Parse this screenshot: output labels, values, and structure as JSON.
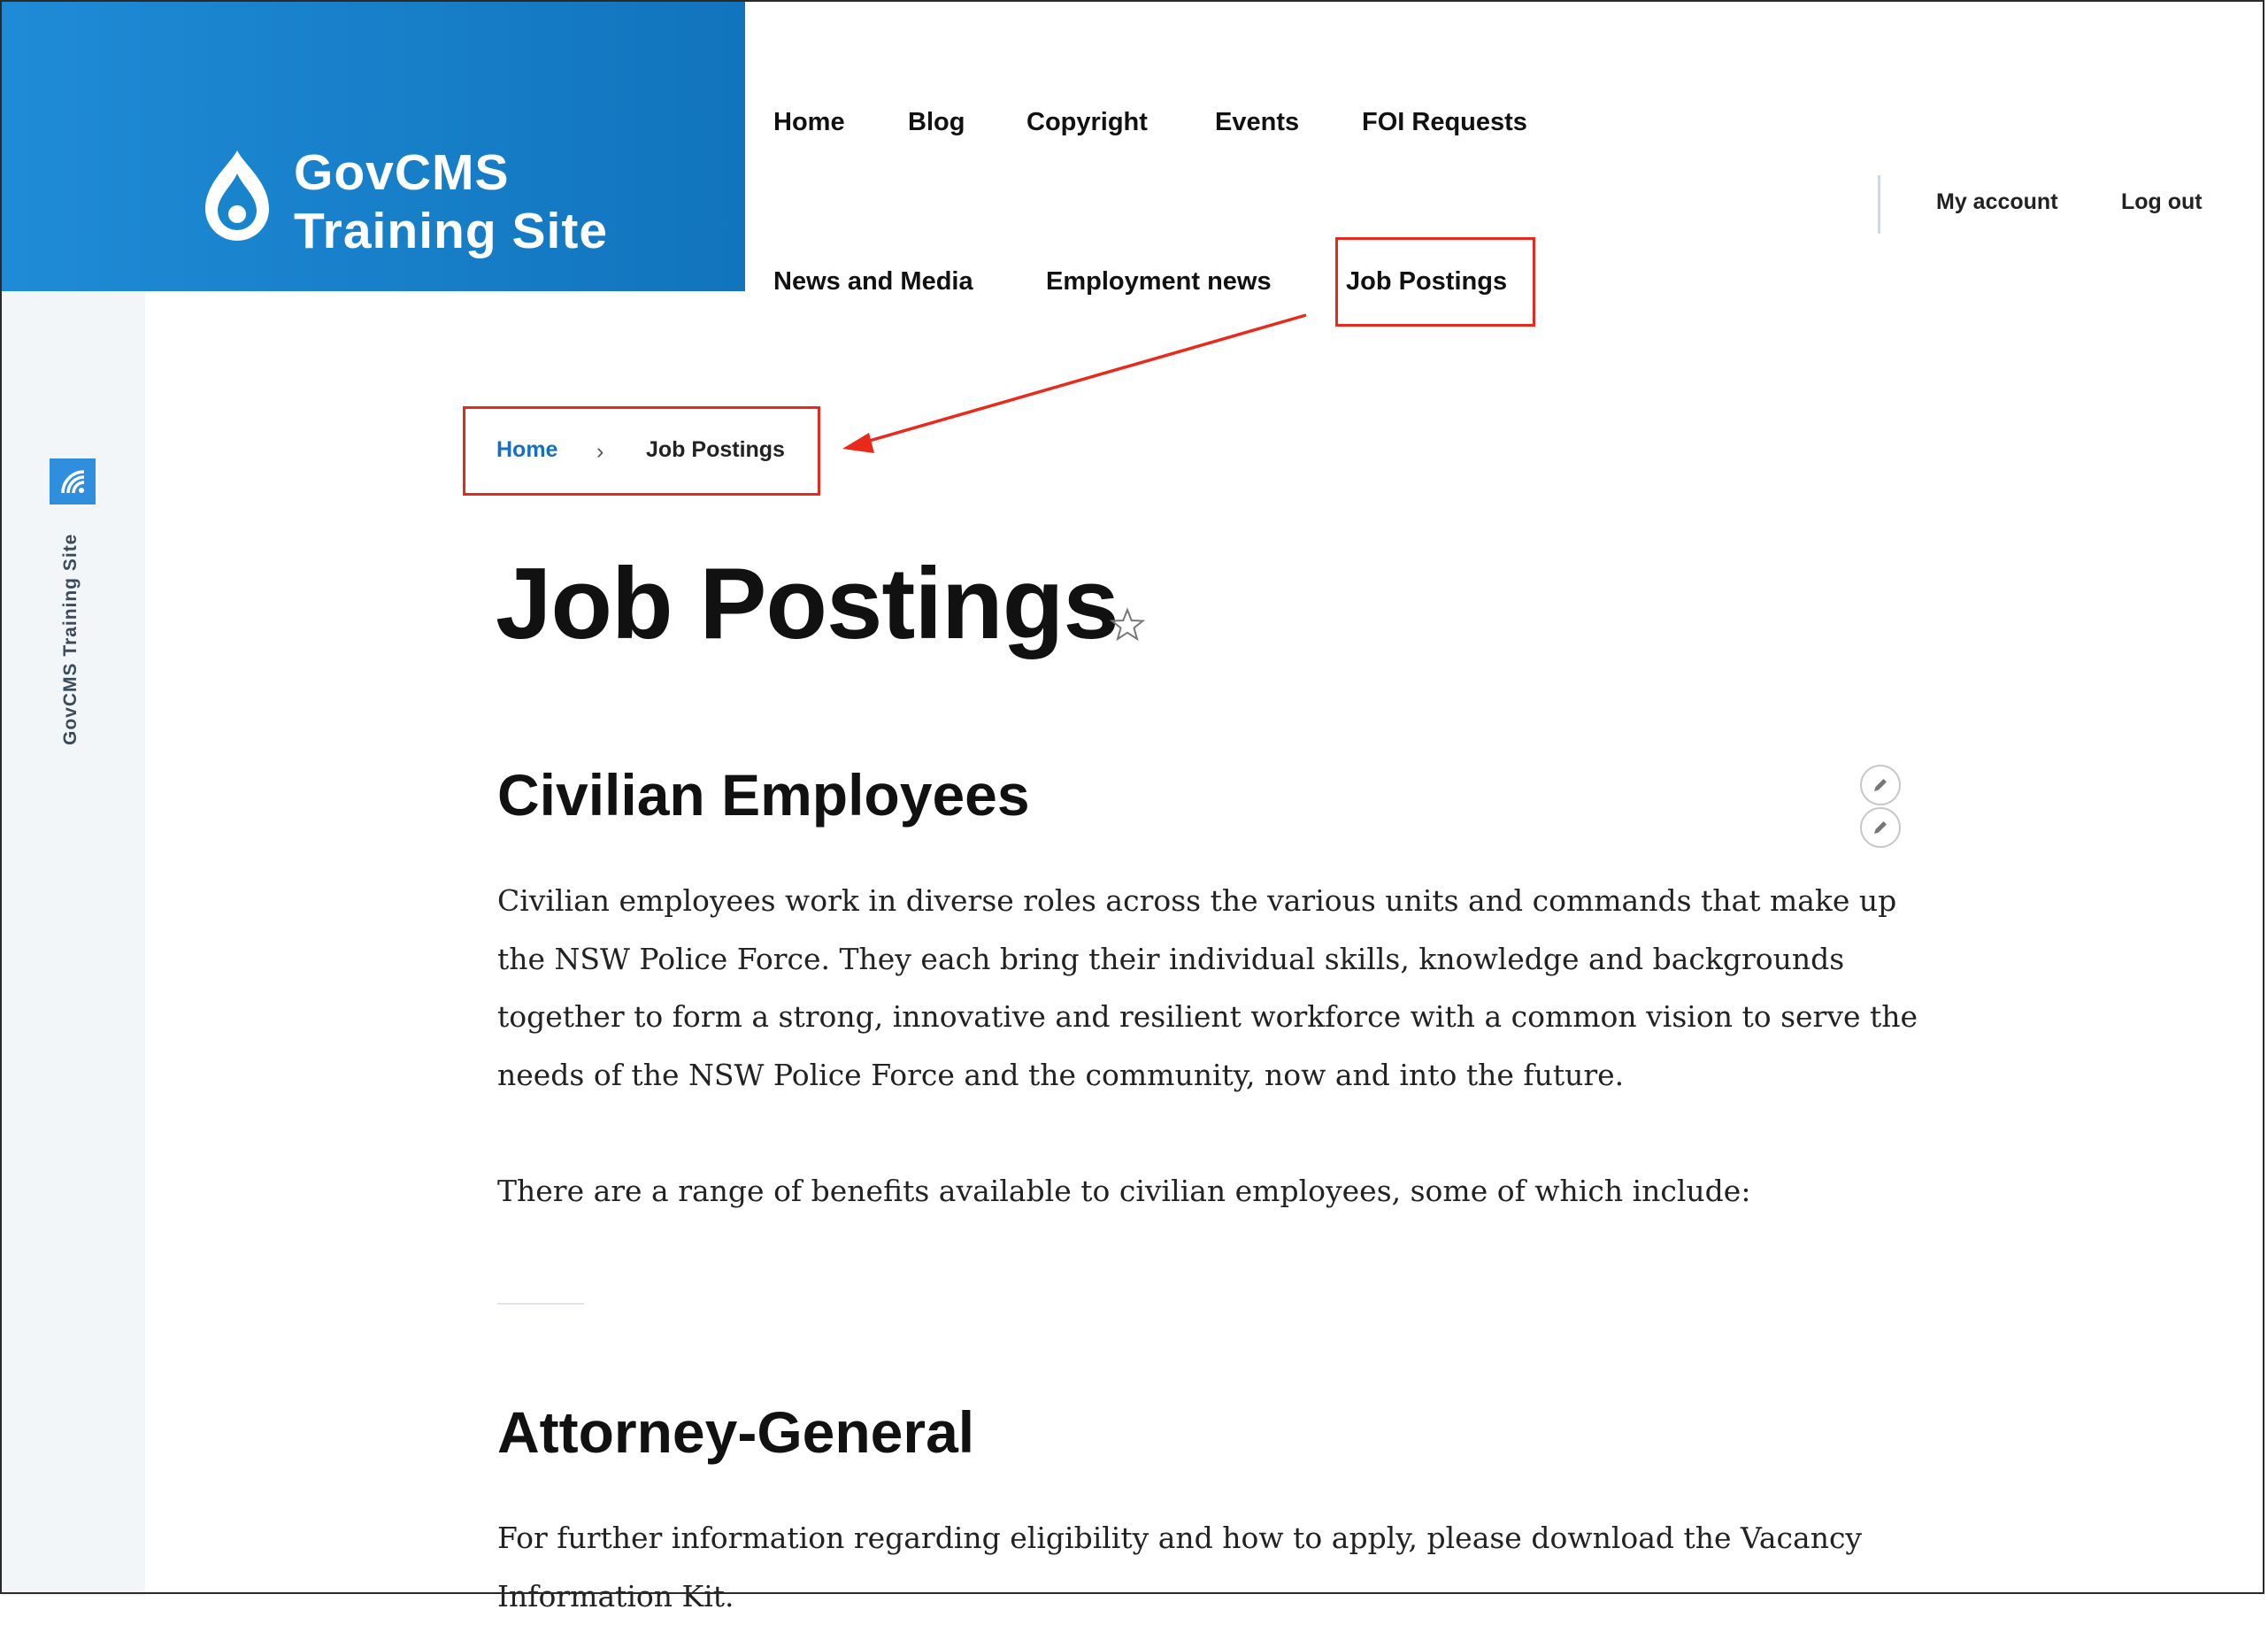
{
  "branding": {
    "line1": "GovCMS",
    "line2": "Training Site",
    "sidebar_label": "GovCMS Training Site",
    "brand_color": "#1f8bd6"
  },
  "nav": {
    "items": [
      "Home",
      "Blog",
      "Copyright",
      "Events",
      "FOI Requests",
      "News and Media",
      "Employment news",
      "Job Postings"
    ]
  },
  "account": {
    "my_account": "My account",
    "log_out": "Log out"
  },
  "breadcrumb": {
    "home": "Home",
    "separator": "›",
    "current": "Job Postings"
  },
  "page": {
    "title": "Job Postings",
    "sections": [
      {
        "heading": "Civilian Employees",
        "paragraphs": [
          "Civilian employees work in diverse roles across the various units and commands that make up the NSW Police Force. They each bring their individual skills, knowledge and backgrounds together to form a strong, innovative and resilient workforce with a common vision to serve the needs of the NSW Police Force and the community, now and into the future.",
          "There are a range of benefits available to civilian employees, some of which include:"
        ]
      },
      {
        "heading": "Attorney-General",
        "paragraphs": [
          "For further information regarding eligibility and how to apply, please download the Vacancy Information Kit."
        ]
      }
    ]
  },
  "annotation_color": "#e8291b"
}
